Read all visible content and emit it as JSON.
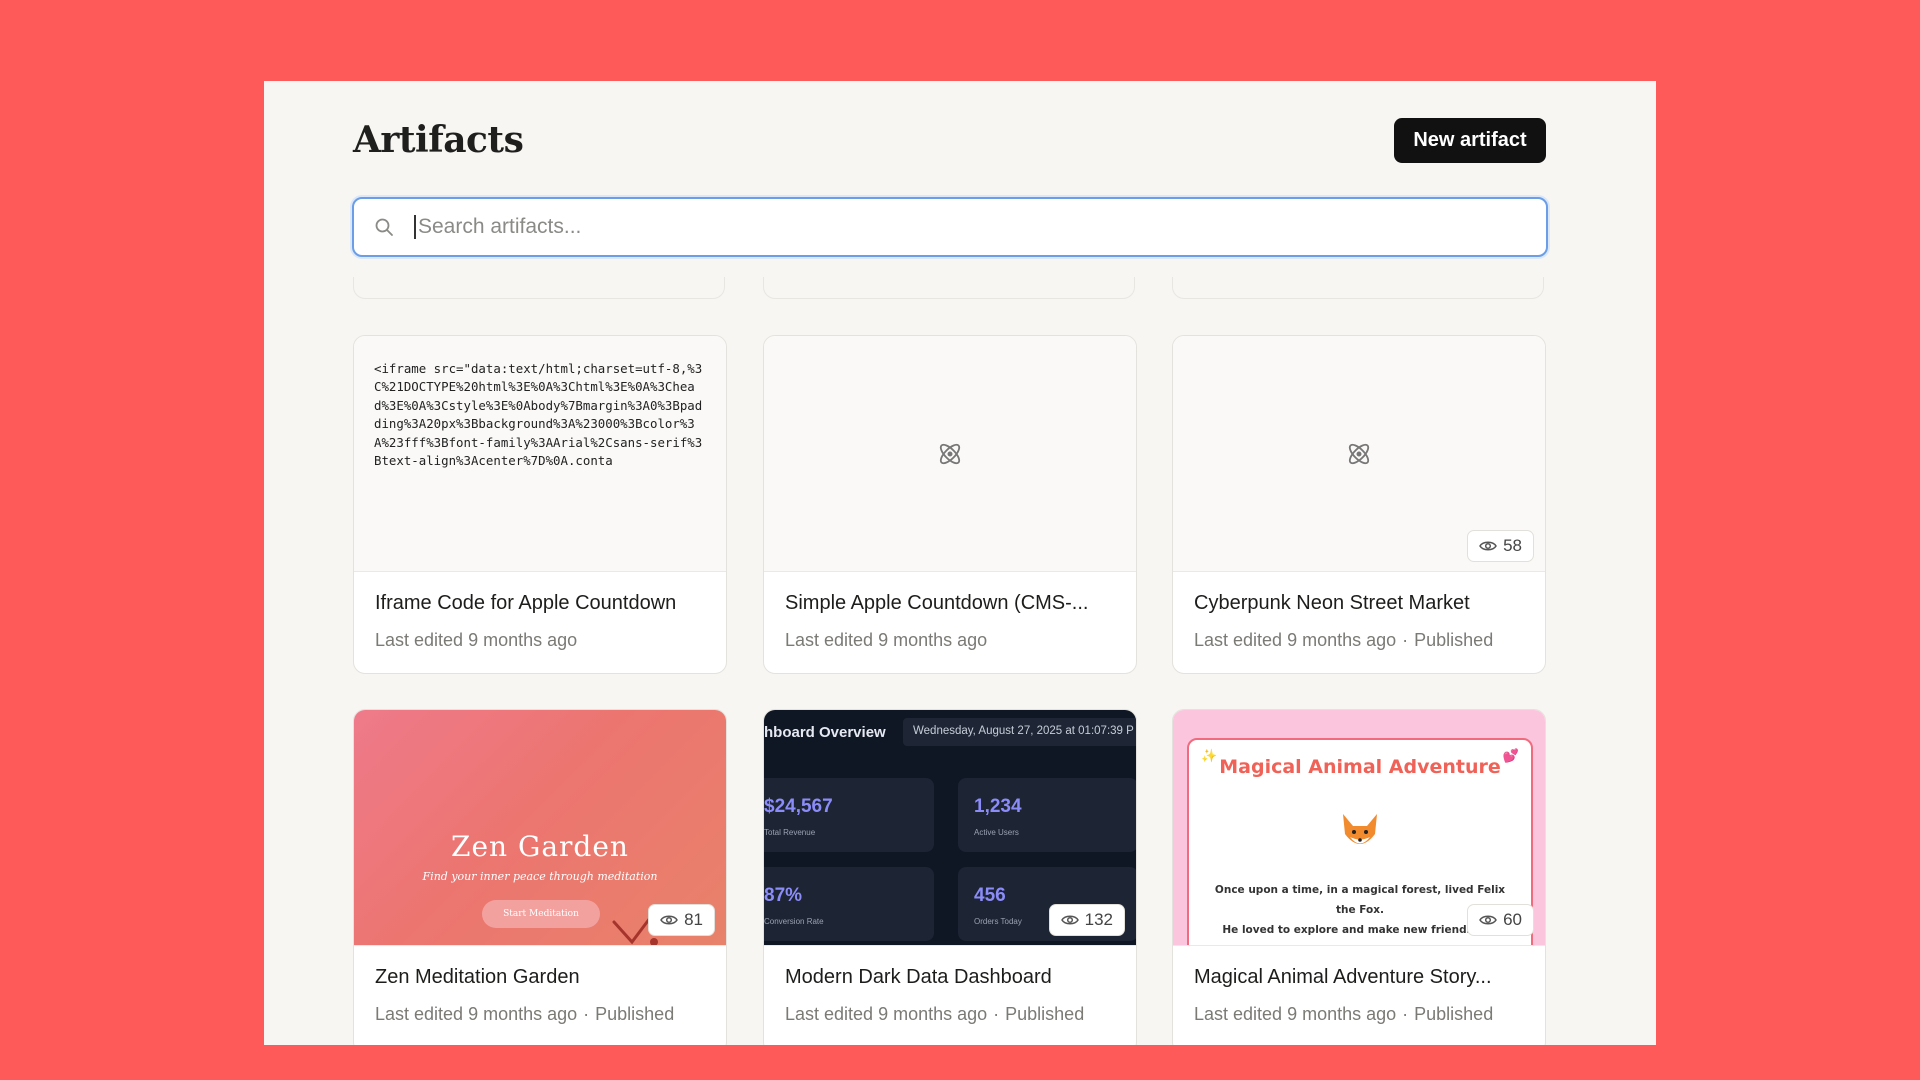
{
  "page": {
    "title": "Artifacts",
    "new_button": "New artifact"
  },
  "search": {
    "placeholder": "Search artifacts...",
    "value": ""
  },
  "cards": [
    {
      "title": "Iframe Code for Apple Countdown",
      "meta": "Last edited 9 months ago",
      "status": "",
      "preview_code": "<iframe src=\"data:text/html;charset=utf-8,%3C%21DOCTYPE%20html%3E%0A%3Chtml%3E%0A%3Chead%3E%0A%3Cstyle%3E%0Abody%7Bmargin%3A0%3Bpadding%3A20px%3Bbackground%3A%23000%3Bcolor%3A%23fff%3Bfont-family%3AArial%2Csans-serif%3Btext-align%3Acenter%7D%0A.conta"
    },
    {
      "title": "Simple Apple Countdown (CMS-...",
      "meta": "Last edited 9 months ago",
      "status": ""
    },
    {
      "title": "Cyberpunk Neon Street Market",
      "meta": "Last edited 9 months ago",
      "status": "Published",
      "views": "58"
    },
    {
      "title": "Zen Meditation Garden",
      "meta": "Last edited 9 months ago",
      "status": "Published",
      "views": "81",
      "preview": {
        "heading": "Zen Garden",
        "subtitle": "Find your inner peace through meditation",
        "button": "Start Meditation"
      }
    },
    {
      "title": "Modern Dark Data Dashboard",
      "meta": "Last edited 9 months ago",
      "status": "Published",
      "views": "132",
      "preview": {
        "heading": "hboard Overview",
        "date": "Wednesday, August 27, 2025 at 01:07:39 P",
        "stats": [
          {
            "value": "$24,567",
            "label": "Total Revenue"
          },
          {
            "value": "1,234",
            "label": "Active Users"
          },
          {
            "value": "87%",
            "label": "Conversion Rate"
          },
          {
            "value": "456",
            "label": "Orders Today"
          }
        ]
      }
    },
    {
      "title": "Magical Animal Adventure Story...",
      "meta": "Last edited 9 months ago",
      "status": "Published",
      "views": "60",
      "preview": {
        "heading": "Magical Animal Adventure",
        "line1": "Once upon a time, in a magical forest, lived Felix the Fox.",
        "line2": "He loved to explore and make new friends eve"
      }
    }
  ],
  "colors": {
    "background": "#ff5a5a",
    "surface": "#f7f6f3",
    "accent": "#6b9ee6",
    "button": "#111111"
  },
  "icons": {
    "search": "search-icon",
    "preview_placeholder": "atom-icon",
    "views": "eye-icon"
  }
}
